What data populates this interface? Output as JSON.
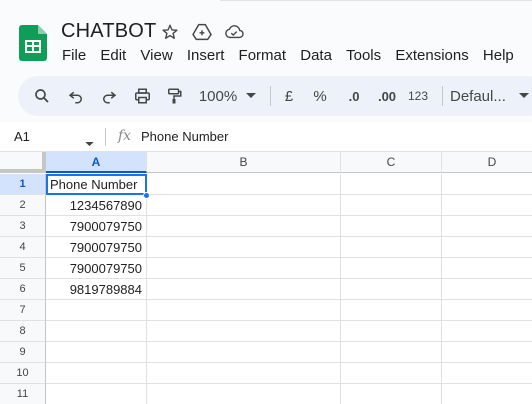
{
  "app": {
    "title": "CHATBOT",
    "logo_icon": "sheets-logo-icon",
    "title_icons": [
      "star-icon",
      "move-to-drive-icon",
      "cloud-saved-icon"
    ]
  },
  "menu": [
    "File",
    "Edit",
    "View",
    "Insert",
    "Format",
    "Data",
    "Tools",
    "Extensions",
    "Help"
  ],
  "toolbar": {
    "zoom": "100%",
    "currency": "£",
    "percent": "%",
    "decrease_decimal": ".0",
    "increase_decimal": ".00",
    "number_format": "123",
    "font": "Defaul...",
    "icons": [
      "search-icon",
      "undo-icon",
      "redo-icon",
      "print-icon",
      "paint-format-icon"
    ]
  },
  "formula_bar": {
    "name_box": "A1",
    "fx_label": "fx",
    "value": "Phone Number"
  },
  "grid": {
    "columns": [
      "A",
      "B",
      "C",
      "D"
    ],
    "selected_column": "A",
    "rows": [
      "1",
      "2",
      "3",
      "4",
      "5",
      "6",
      "7",
      "8",
      "9",
      "10",
      "11"
    ],
    "selected_row": "1",
    "column_a": [
      "Phone Number",
      "1234567890",
      "7900079750",
      "7900079750",
      "7900079750",
      "9819789884",
      "",
      "",
      "",
      "",
      ""
    ]
  },
  "colors": {
    "selection": "#1a73e8",
    "header_selected_bg": "#d3e3fd",
    "toolbar_bg": "#edf2fa",
    "sheets_green": "#0f9d58"
  }
}
